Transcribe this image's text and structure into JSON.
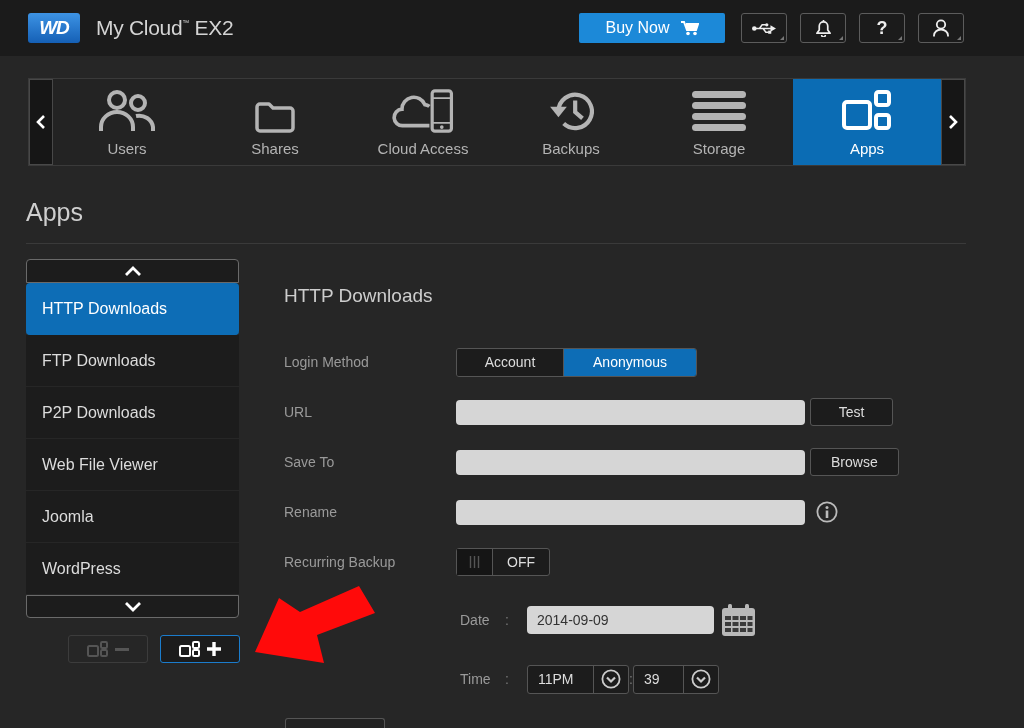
{
  "header": {
    "logo": "WD",
    "title": "My Cloud$^{™}$ EX2",
    "buy_button": "Buy Now",
    "icon_buttons": [
      {
        "kind": "usb"
      },
      {
        "kind": "notifications"
      },
      {
        "kind": "help",
        "label": "?"
      },
      {
        "kind": "account"
      }
    ]
  },
  "nav": {
    "items": [
      {
        "kind": "users",
        "label": "Users",
        "selected": false
      },
      {
        "kind": "shares",
        "label": "Shares",
        "selected": false
      },
      {
        "kind": "cloud",
        "label": "Cloud Access",
        "selected": false
      },
      {
        "kind": "backups",
        "label": "Backups",
        "selected": false
      },
      {
        "kind": "storage",
        "label": "Storage",
        "selected": false
      },
      {
        "kind": "apps",
        "label": "Apps",
        "selected": true
      }
    ]
  },
  "page_title": "Apps",
  "sidebar": {
    "items": [
      {
        "label": "HTTP Downloads",
        "selected": true
      },
      {
        "label": "FTP Downloads",
        "selected": false
      },
      {
        "label": "P2P Downloads",
        "selected": false
      },
      {
        "label": "Web File Viewer",
        "selected": false
      },
      {
        "label": "Joomla",
        "selected": false
      },
      {
        "label": "WordPress",
        "selected": false
      }
    ],
    "buttons": [
      {
        "kind": "remove",
        "disabled": true,
        "focused": false
      },
      {
        "kind": "add",
        "disabled": false,
        "focused": true
      }
    ]
  },
  "form": {
    "title": "HTTP Downloads",
    "rows": [
      {
        "kind": "segmented",
        "label": "Login Method",
        "options": [
          {
            "label": "Account",
            "selected": false
          },
          {
            "label": "Anonymous",
            "selected": true
          }
        ]
      },
      {
        "kind": "field",
        "label": "URL",
        "button": "Test",
        "info": false
      },
      {
        "kind": "field",
        "label": "Save To",
        "button": "Browse",
        "info": false
      },
      {
        "kind": "field",
        "label": "Rename",
        "info": true
      },
      {
        "kind": "toggle",
        "label": "Recurring Backup",
        "on": false,
        "state_text": "OFF"
      }
    ]
  },
  "schedule": {
    "date": {
      "label": "Date",
      "separator": ":",
      "value": "2014-09-09"
    },
    "time": {
      "label": "Time",
      "separator": ":",
      "hour": "11PM",
      "minute_separator": ":",
      "minute": "39"
    }
  }
}
